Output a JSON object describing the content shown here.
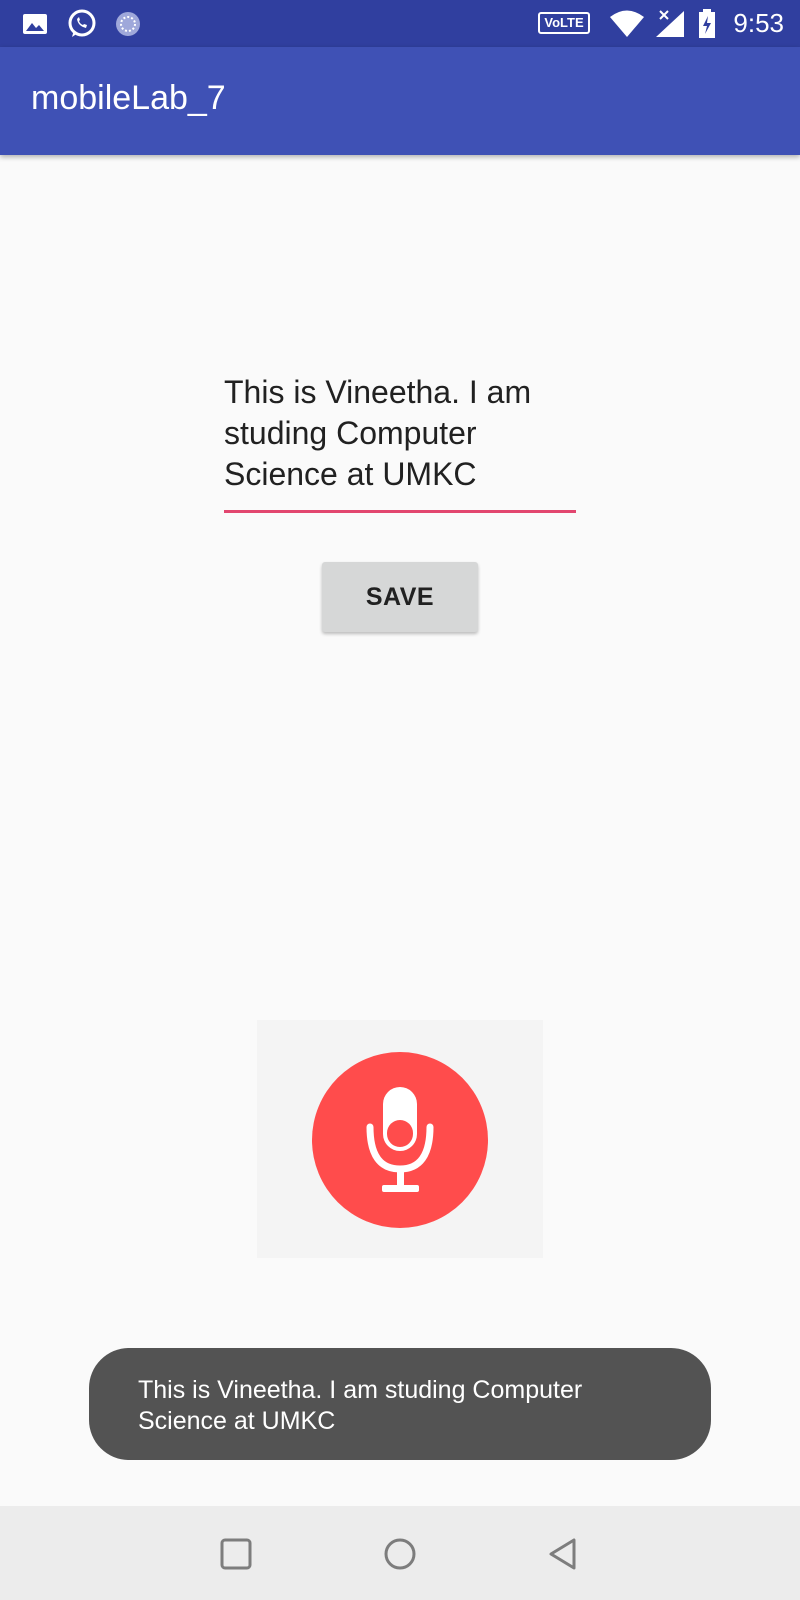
{
  "status_bar": {
    "time": "9:53",
    "volte_label": "VoLTE",
    "icons": [
      "image-icon",
      "whatsapp-icon",
      "sync-icon",
      "volte-icon",
      "wifi-icon",
      "signal-icon",
      "battery-charging-icon"
    ]
  },
  "app_bar": {
    "title": "mobileLab_7"
  },
  "main": {
    "input_text": "This is Vineetha. I am studing Computer Science at UMKC",
    "save_label": "SAVE",
    "mic_icon": "mic-icon"
  },
  "toast": {
    "message": "This is Vineetha. I am studing Computer Science at UMKC"
  },
  "nav_bar": {
    "icons": [
      "recents-icon",
      "home-icon",
      "back-icon"
    ]
  },
  "colors": {
    "status_bar": "#303f9f",
    "app_bar": "#3f51b5",
    "accent": "#e2466f",
    "mic": "#ff4c4c",
    "toast": "#535353"
  }
}
